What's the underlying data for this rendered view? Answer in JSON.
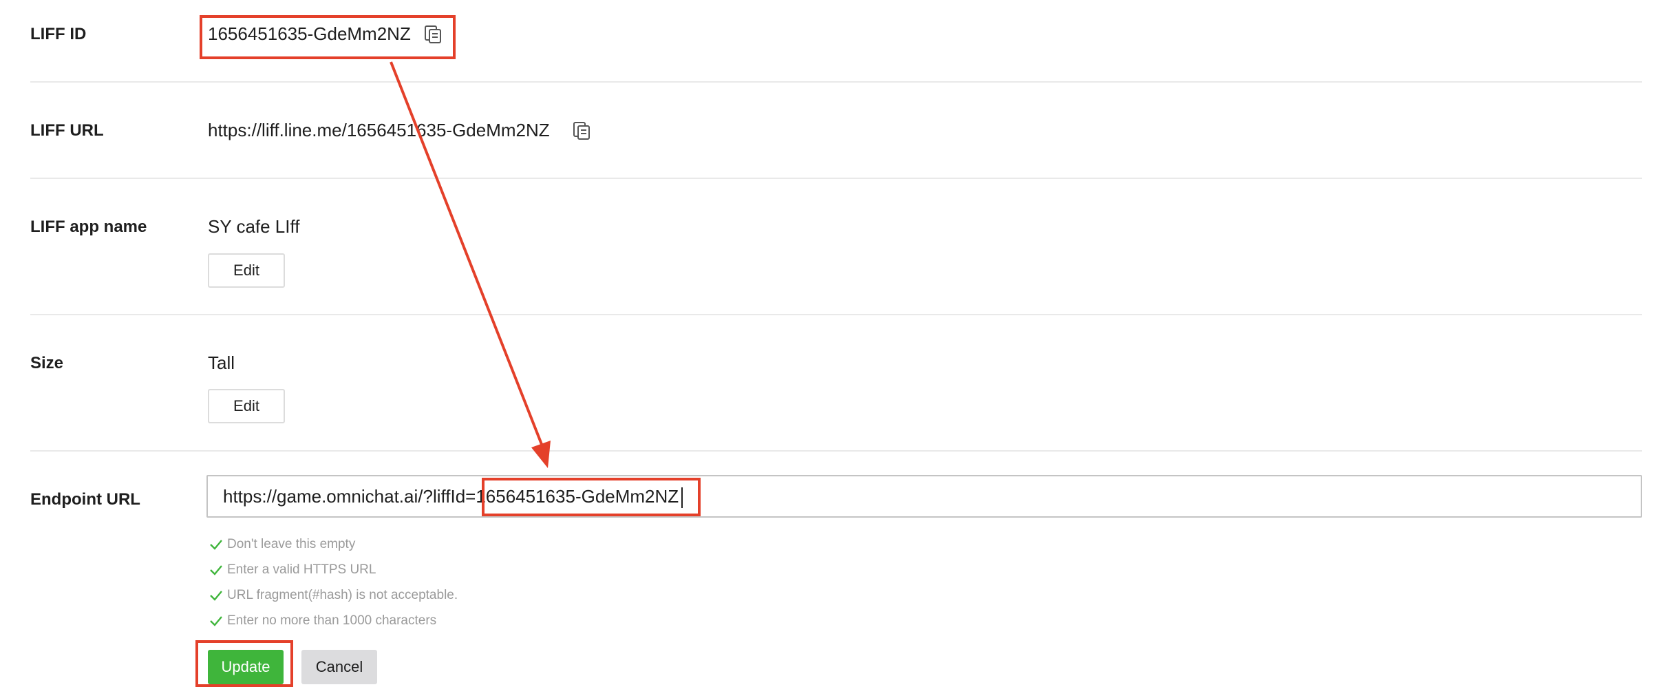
{
  "liff_id": {
    "label": "LIFF ID",
    "value": "1656451635-GdeMm2NZ"
  },
  "liff_url": {
    "label": "LIFF URL",
    "value": "https://liff.line.me/1656451635-GdeMm2NZ"
  },
  "app_name": {
    "label": "LIFF app name",
    "value": "SY cafe LIff",
    "edit_label": "Edit"
  },
  "size": {
    "label": "Size",
    "value": "Tall",
    "edit_label": "Edit"
  },
  "endpoint": {
    "label": "Endpoint URL",
    "value": "https://game.omnichat.ai/?liffId=1656451635-GdeMm2NZ",
    "validations": [
      "Don't leave this empty",
      "Enter a valid HTTPS URL",
      "URL fragment(#hash) is not acceptable.",
      "Enter no more than 1000 characters"
    ],
    "update_label": "Update",
    "cancel_label": "Cancel"
  },
  "colors": {
    "accent_green": "#3fb53b",
    "annotation_red": "#e4402a",
    "validation_check": "#3fb53b"
  },
  "icons": [
    "copy-icon",
    "check-icon"
  ]
}
